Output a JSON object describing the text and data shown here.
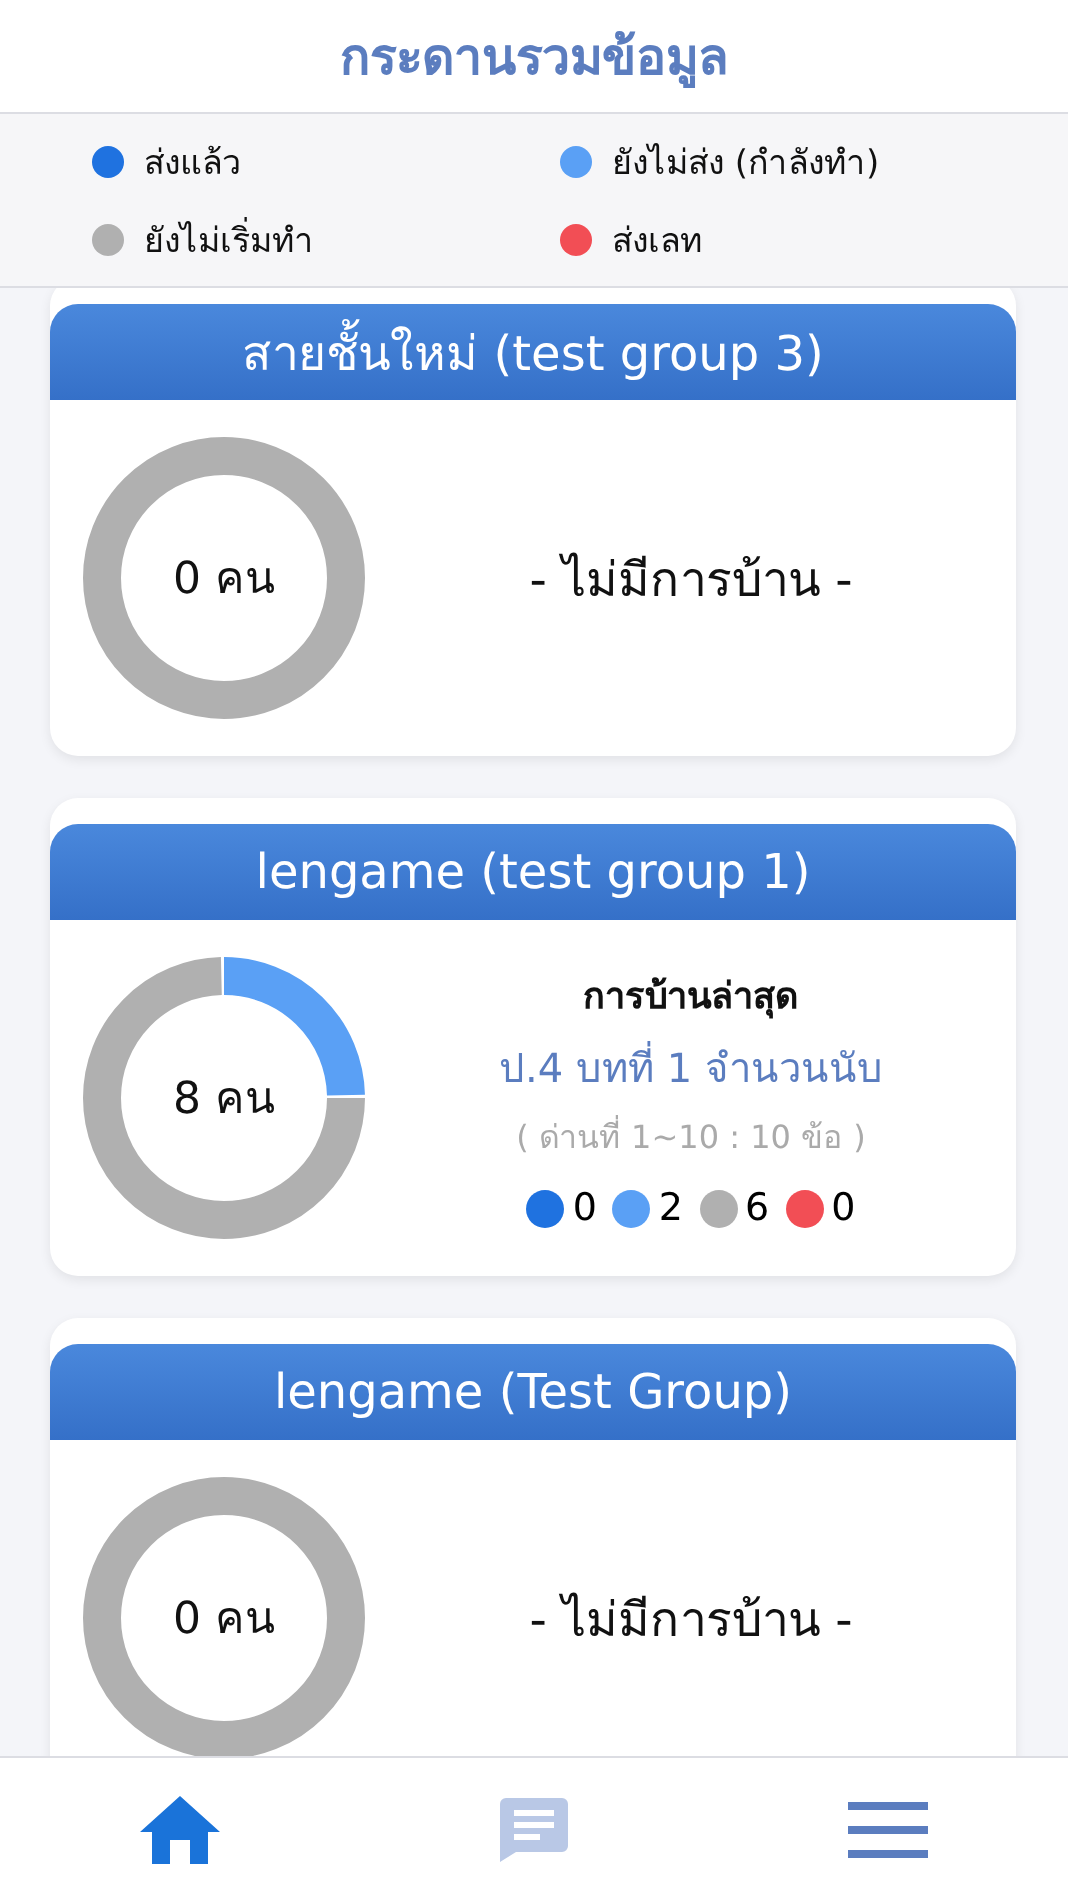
{
  "header": {
    "title": "กระดานรวมข้อมูล"
  },
  "legend": [
    {
      "label": "ส่งแล้ว",
      "color": "#1f72e0"
    },
    {
      "label": "ยังไม่ส่ง (กำลังทำ)",
      "color": "#5aa0f5"
    },
    {
      "label": "ยังไม่เริ่มทำ",
      "color": "#b0b0b0"
    },
    {
      "label": "ส่งเลท",
      "color": "#f24e55"
    }
  ],
  "cards": [
    {
      "kind": "empty",
      "title": "สายชั้นใหม่ (test group 3)",
      "total": "0 คน",
      "message": "- ไม่มีการบ้าน -"
    },
    {
      "kind": "homework",
      "title": "lengame (test group 1)",
      "total": "8 คน",
      "heading": "การบ้านล่าสุด",
      "homework": "ป.4 บทที่ 1 จำนวนนับ",
      "detail": "( ด่านที่ 1~10 : 10 ข้อ )",
      "counts": [
        {
          "value": "0",
          "color": "#1f72e0"
        },
        {
          "value": "2",
          "color": "#5aa0f5"
        },
        {
          "value": "6",
          "color": "#b0b0b0"
        },
        {
          "value": "0",
          "color": "#f24e55"
        }
      ]
    },
    {
      "kind": "empty",
      "title": "lengame (Test Group)",
      "total": "0 คน",
      "message": "- ไม่มีการบ้าน -"
    }
  ],
  "nav": [
    {
      "kind": "home",
      "selected": true
    },
    {
      "kind": "chat",
      "selected": false
    },
    {
      "kind": "menu",
      "selected": false
    }
  ]
}
